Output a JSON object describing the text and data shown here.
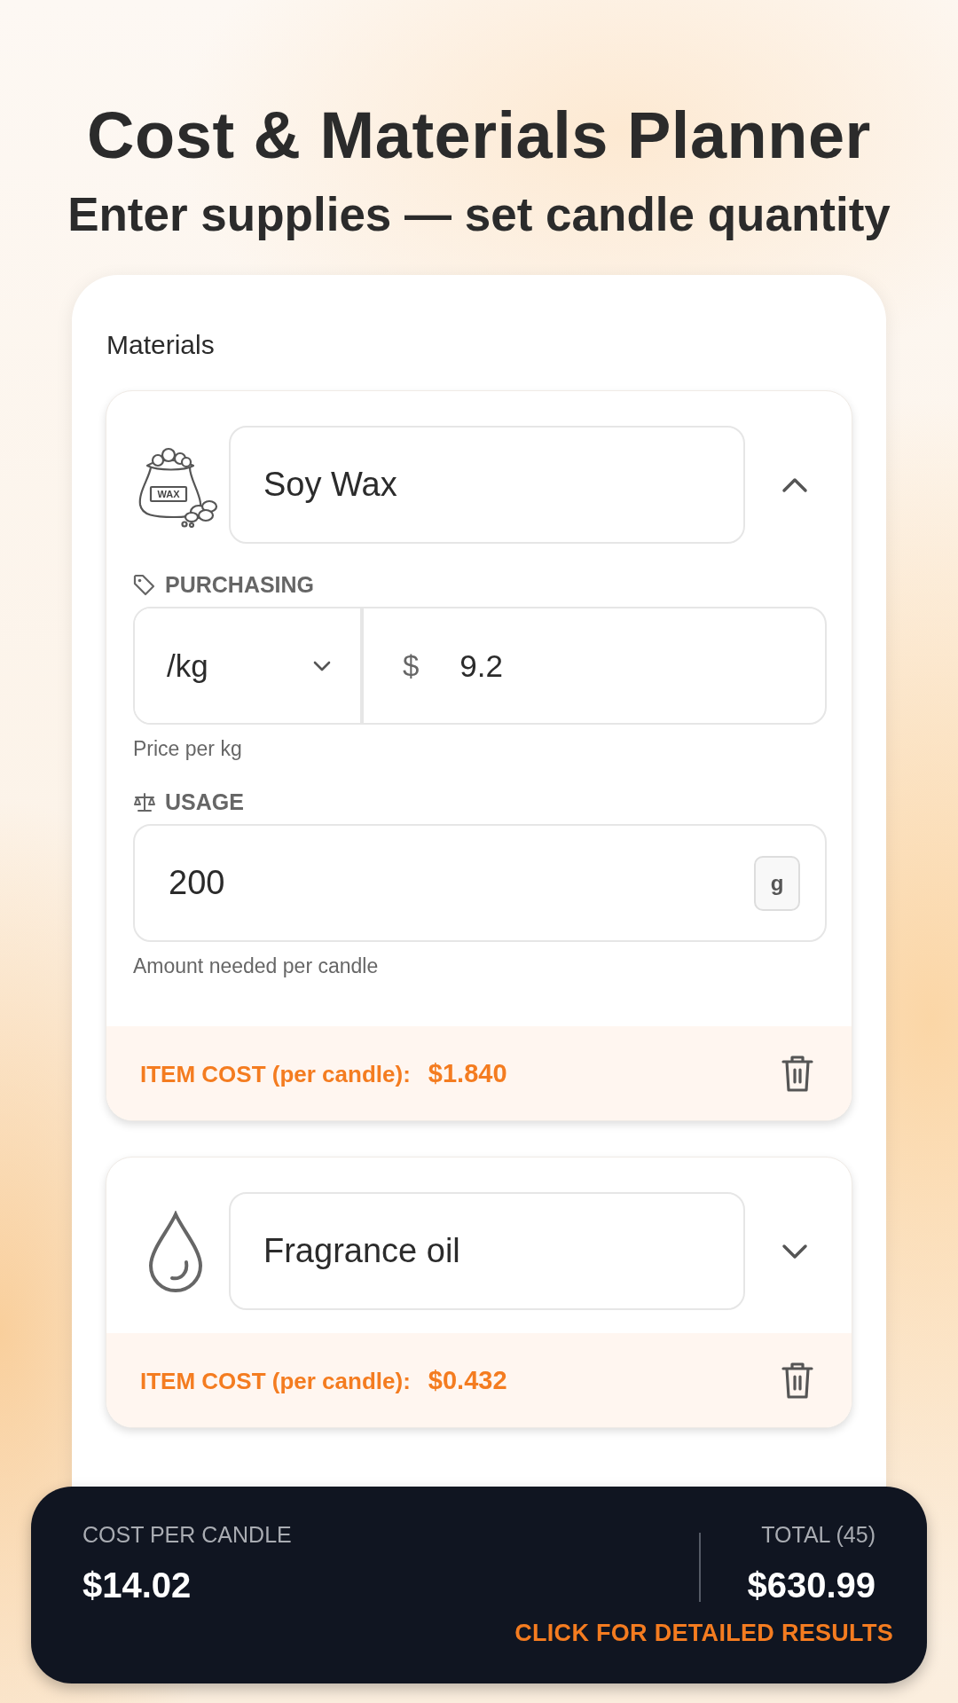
{
  "header": {
    "title": "Cost & Materials Planner",
    "subtitle": "Enter supplies — set candle quantity"
  },
  "section_label": "Materials",
  "materials": [
    {
      "kind": "wax",
      "name": "Soy Wax",
      "icon_label": "WAX",
      "expanded": true,
      "purchasing": {
        "label": "PURCHASING",
        "unit": "/kg",
        "currency": "$",
        "price": "9.2",
        "hint": "Price per kg"
      },
      "usage": {
        "label": "USAGE",
        "value": "200",
        "unit": "g",
        "hint": "Amount needed per candle"
      },
      "cost_label": "ITEM COST (per candle):",
      "cost": "$1.840"
    },
    {
      "kind": "drop",
      "name": "Fragrance oil",
      "expanded": false,
      "cost_label": "ITEM COST (per candle):",
      "cost": "$0.432"
    }
  ],
  "summary": {
    "per_candle_label": "COST PER CANDLE",
    "per_candle": "$14.02",
    "total_label": "TOTAL (45)",
    "total": "$630.99",
    "action": "CLICK FOR DETAILED RESULTS"
  }
}
